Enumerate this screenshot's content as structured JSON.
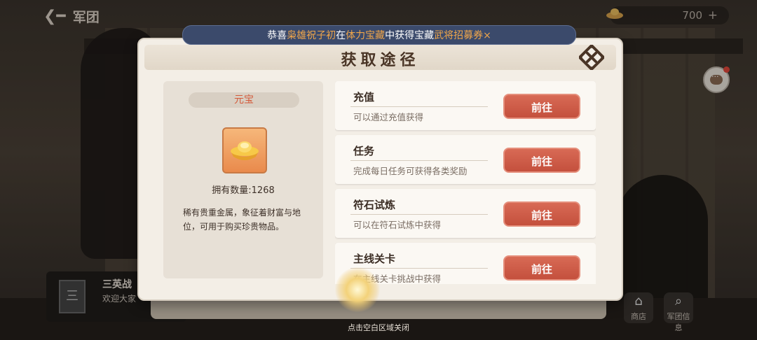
{
  "topbar": {
    "back_label": "军团",
    "currency_value": "700",
    "currency_plus": "+"
  },
  "announcement": {
    "prefix": "恭喜",
    "player": "枭雄祝子初",
    "mid1": "在",
    "location": "体力宝藏",
    "mid2": "中获得宝藏",
    "reward": "武将招募券×"
  },
  "dialog": {
    "title": "获取途径",
    "item": {
      "name": "元宝",
      "count_label": "拥有数量:1268",
      "description": "稀有贵重金属，象征着财富与地位，可用于购买珍贵物品。"
    },
    "sources": [
      {
        "title": "充值",
        "desc": "可以通过充值获得",
        "button": "前往"
      },
      {
        "title": "任务",
        "desc": "完成每日任务可获得各类奖励",
        "button": "前往"
      },
      {
        "title": "符石试炼",
        "desc": "可以在符石试炼中获得",
        "button": "前往"
      },
      {
        "title": "主线关卡",
        "desc": "在主线关卡挑战中获得",
        "button": "前往"
      }
    ]
  },
  "guild": {
    "name": "三英战",
    "sub": "欢迎大家"
  },
  "side_buttons": {
    "shop": "商店",
    "guild_info": "军团信息"
  },
  "close_hint": "点击空白区域关闭",
  "colors": {
    "accent_red": "#c4503d",
    "announce_highlight": "#f0a64a",
    "item_name": "#d45a3a"
  }
}
